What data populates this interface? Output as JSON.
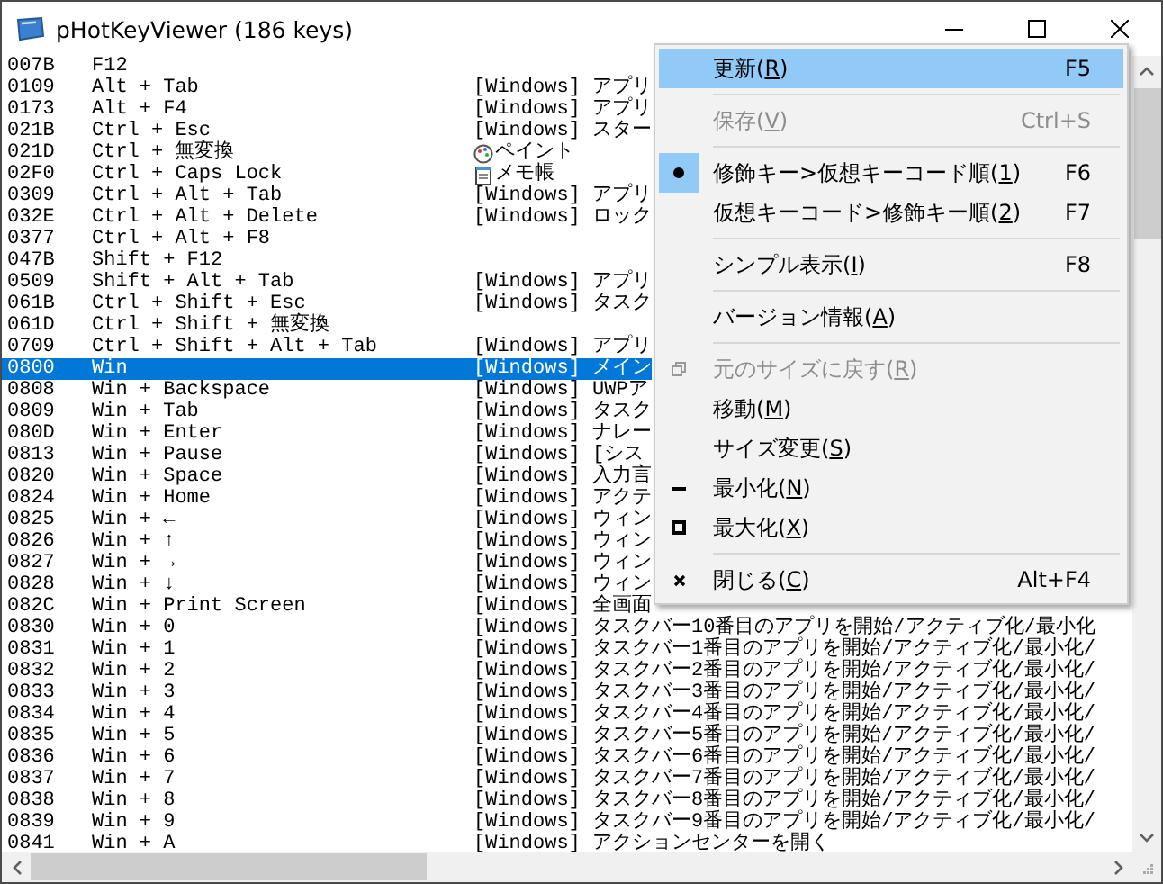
{
  "window": {
    "title": "pHotKeyViewer (186 keys)"
  },
  "rows": [
    {
      "code": "007B",
      "keys": "F12",
      "selected": false
    },
    {
      "code": "0109",
      "keys": "Alt + Tab",
      "desc": "[Windows] アプリ",
      "selected": false
    },
    {
      "code": "0173",
      "keys": "Alt + F4",
      "desc": "[Windows] アプリ",
      "selected": false
    },
    {
      "code": "021B",
      "keys": "Ctrl + Esc",
      "desc": "[Windows] スター",
      "selected": false
    },
    {
      "code": "021D",
      "keys": "Ctrl + 無変換",
      "desc": "ペイント",
      "kind": "paint",
      "selected": false
    },
    {
      "code": "02F0",
      "keys": "Ctrl + Caps Lock",
      "desc": "メモ帳",
      "kind": "notepad",
      "selected": false
    },
    {
      "code": "0309",
      "keys": "Ctrl + Alt + Tab",
      "desc": "[Windows] アプリ",
      "selected": false
    },
    {
      "code": "032E",
      "keys": "Ctrl + Alt + Delete",
      "desc": "[Windows] ロック",
      "selected": false
    },
    {
      "code": "0377",
      "keys": "Ctrl + Alt + F8",
      "selected": false
    },
    {
      "code": "047B",
      "keys": "Shift + F12",
      "selected": false
    },
    {
      "code": "0509",
      "keys": "Shift + Alt + Tab",
      "desc": "[Windows] アプリ",
      "selected": false
    },
    {
      "code": "061B",
      "keys": "Ctrl + Shift + Esc",
      "desc": "[Windows] タスク",
      "selected": false
    },
    {
      "code": "061D",
      "keys": "Ctrl + Shift + 無変換",
      "selected": false
    },
    {
      "code": "0709",
      "keys": "Ctrl + Shift + Alt + Tab",
      "desc": "[Windows] アプリ",
      "selected": false
    },
    {
      "code": "0800",
      "keys": "Win",
      "desc": "[Windows] メイン",
      "selected": true
    },
    {
      "code": "0808",
      "keys": "Win + Backspace",
      "desc": "[Windows] UWPア",
      "selected": false
    },
    {
      "code": "0809",
      "keys": "Win + Tab",
      "desc": "[Windows] タスク",
      "selected": false
    },
    {
      "code": "080D",
      "keys": "Win + Enter",
      "desc": "[Windows] ナレー",
      "selected": false
    },
    {
      "code": "0813",
      "keys": "Win + Pause",
      "desc": "[Windows] [シス",
      "selected": false
    },
    {
      "code": "0820",
      "keys": "Win + Space",
      "desc": "[Windows] 入力言",
      "selected": false
    },
    {
      "code": "0824",
      "keys": "Win + Home",
      "desc": "[Windows] アクテ",
      "selected": false
    },
    {
      "code": "0825",
      "keys": "Win + ←",
      "desc": "[Windows] ウィン",
      "selected": false
    },
    {
      "code": "0826",
      "keys": "Win + ↑",
      "desc": "[Windows] ウィン",
      "selected": false
    },
    {
      "code": "0827",
      "keys": "Win + →",
      "desc": "[Windows] ウィン",
      "selected": false
    },
    {
      "code": "0828",
      "keys": "Win + ↓",
      "desc": "[Windows] ウィン",
      "selected": false
    },
    {
      "code": "082C",
      "keys": "Win + Print Screen",
      "desc": "[Windows] 全画面",
      "selected": false
    },
    {
      "code": "0830",
      "keys": "Win + 0",
      "desc": "[Windows] タスクバー10番目のアプリを開始/アクティブ化/最小化",
      "selected": false
    },
    {
      "code": "0831",
      "keys": "Win + 1",
      "desc": "[Windows] タスクバー1番目のアプリを開始/アクティブ化/最小化/",
      "selected": false
    },
    {
      "code": "0832",
      "keys": "Win + 2",
      "desc": "[Windows] タスクバー2番目のアプリを開始/アクティブ化/最小化/",
      "selected": false
    },
    {
      "code": "0833",
      "keys": "Win + 3",
      "desc": "[Windows] タスクバー3番目のアプリを開始/アクティブ化/最小化/",
      "selected": false
    },
    {
      "code": "0834",
      "keys": "Win + 4",
      "desc": "[Windows] タスクバー4番目のアプリを開始/アクティブ化/最小化/",
      "selected": false
    },
    {
      "code": "0835",
      "keys": "Win + 5",
      "desc": "[Windows] タスクバー5番目のアプリを開始/アクティブ化/最小化/",
      "selected": false
    },
    {
      "code": "0836",
      "keys": "Win + 6",
      "desc": "[Windows] タスクバー6番目のアプリを開始/アクティブ化/最小化/",
      "selected": false
    },
    {
      "code": "0837",
      "keys": "Win + 7",
      "desc": "[Windows] タスクバー7番目のアプリを開始/アクティブ化/最小化/",
      "selected": false
    },
    {
      "code": "0838",
      "keys": "Win + 8",
      "desc": "[Windows] タスクバー8番目のアプリを開始/アクティブ化/最小化/",
      "selected": false
    },
    {
      "code": "0839",
      "keys": "Win + 9",
      "desc": "[Windows] タスクバー9番目のアプリを開始/アクティブ化/最小化/",
      "selected": false
    },
    {
      "code": "0841",
      "keys": "Win + A",
      "desc": "[Windows] アクションセンターを開く",
      "selected": false
    }
  ],
  "menu": [
    {
      "kind": "item",
      "label": "更新(R)",
      "shortcut": "F5",
      "selected": true,
      "disabled": false,
      "checked": false
    },
    {
      "kind": "separator"
    },
    {
      "kind": "item",
      "label": "保存(V)",
      "shortcut": "Ctrl+S",
      "selected": false,
      "disabled": true,
      "checked": false
    },
    {
      "kind": "separator"
    },
    {
      "kind": "item",
      "label": "修飾キー>仮想キーコード順(1)",
      "shortcut": "F6",
      "selected": false,
      "disabled": false,
      "checked": true
    },
    {
      "kind": "item",
      "label": "仮想キーコード>修飾キー順(2)",
      "shortcut": "F7",
      "selected": false,
      "disabled": false,
      "checked": false
    },
    {
      "kind": "separator"
    },
    {
      "kind": "item",
      "label": "シンプル表示(I)",
      "shortcut": "F8",
      "selected": false,
      "disabled": false,
      "checked": false
    },
    {
      "kind": "separator"
    },
    {
      "kind": "item",
      "label": "バージョン情報(A)",
      "selected": false,
      "disabled": false,
      "checked": false
    },
    {
      "kind": "separator"
    },
    {
      "kind": "restore",
      "label": "元のサイズに戻す(R)",
      "selected": false,
      "disabled": true,
      "checked": false
    },
    {
      "kind": "item",
      "label": "移動(M)",
      "selected": false,
      "disabled": false,
      "checked": false
    },
    {
      "kind": "item",
      "label": "サイズ変更(S)",
      "selected": false,
      "disabled": false,
      "checked": false
    },
    {
      "kind": "minimize",
      "label": "最小化(N)",
      "selected": false,
      "disabled": false,
      "checked": false
    },
    {
      "kind": "maximize",
      "label": "最大化(X)",
      "selected": false,
      "disabled": false,
      "checked": false
    },
    {
      "kind": "separator"
    },
    {
      "kind": "close",
      "label": "閉じる(C)",
      "shortcut": "Alt+F4",
      "selected": false,
      "disabled": false,
      "checked": false
    }
  ]
}
